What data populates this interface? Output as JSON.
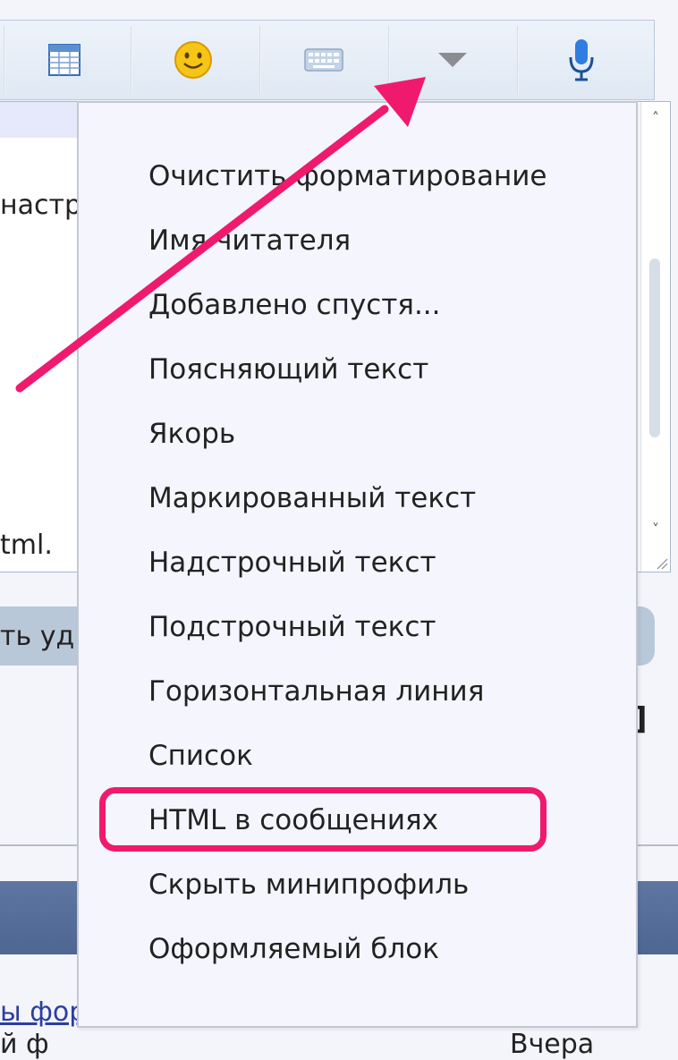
{
  "toolbar": {
    "buttons": [
      {
        "name": "table-icon"
      },
      {
        "name": "smiley-icon"
      },
      {
        "name": "keyboard-icon"
      },
      {
        "name": "dropdown-arrow-icon"
      },
      {
        "name": "microphone-icon"
      }
    ]
  },
  "editor": {
    "line1": "настра",
    "line2": "tml."
  },
  "behind": {
    "button_text": "ть уд",
    "bracket": "]",
    "link": "ы фор",
    "bottom_left": "й ф",
    "bottom_right": "Вчера"
  },
  "menu": {
    "items": [
      {
        "label": "Очистить форматирование"
      },
      {
        "label": "Имя читателя"
      },
      {
        "label": "Добавлено спустя..."
      },
      {
        "label": "Поясняющий текст"
      },
      {
        "label": "Якорь"
      },
      {
        "label": "Маркированный текст"
      },
      {
        "label": "Надстрочный текст"
      },
      {
        "label": "Подстрочный текст"
      },
      {
        "label": "Горизонтальная линия"
      },
      {
        "label": "Список"
      },
      {
        "label": "HTML в сообщениях"
      },
      {
        "label": "Скрыть минипрофиль"
      },
      {
        "label": "Оформляемый блок"
      }
    ],
    "highlighted_index": 10
  },
  "colors": {
    "annotation": "#ef1a6e",
    "toolbar_bg": "#e4ecf6",
    "menu_bg": "#f4f5fd"
  }
}
